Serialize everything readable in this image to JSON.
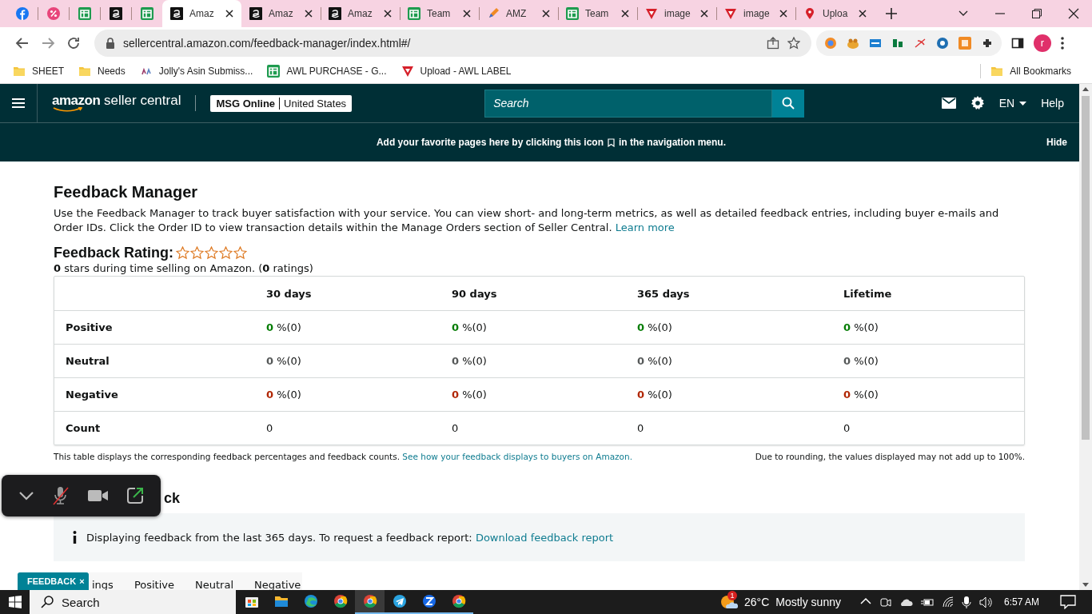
{
  "browser": {
    "tabs": [
      {
        "kind": "facebook",
        "selected": false
      },
      {
        "kind": "percent",
        "selected": false
      },
      {
        "kind": "sheet",
        "selected": false
      },
      {
        "kind": "amazon",
        "selected": false
      },
      {
        "kind": "sheet",
        "selected": false
      },
      {
        "kind": "amazon",
        "title": "Amaz",
        "selected": true
      },
      {
        "kind": "amazon",
        "title": "Amaz",
        "selected": false
      },
      {
        "kind": "amazon",
        "title": "Amaz",
        "selected": false
      },
      {
        "kind": "sheet",
        "title": "Team",
        "selected": false
      },
      {
        "kind": "pen",
        "title": "AMZ",
        "selected": false
      },
      {
        "kind": "sheet",
        "title": "Team",
        "selected": false
      },
      {
        "kind": "triangle",
        "title": "image",
        "selected": false
      },
      {
        "kind": "triangle",
        "title": "image",
        "selected": false
      },
      {
        "kind": "pin",
        "title": "Uploa",
        "selected": false
      }
    ],
    "address": "sellercentral.amazon.com/feedback-manager/index.html#/",
    "profile": "r",
    "bookmarks": [
      {
        "kind": "folder",
        "label": "SHEET"
      },
      {
        "kind": "folder",
        "label": "Needs"
      },
      {
        "kind": "figure",
        "label": "Jolly's Asin Submiss..."
      },
      {
        "kind": "sheet",
        "label": "AWL PURCHASE - G..."
      },
      {
        "kind": "triangle",
        "label": "Upload - AWL LABEL"
      }
    ],
    "all_bookmarks": "All Bookmarks"
  },
  "header": {
    "logo_word": "amazon",
    "logo_rest": "seller central",
    "store": "MSG Online",
    "region": "United States",
    "search_placeholder": "Search",
    "language": "EN",
    "help": "Help"
  },
  "banner": {
    "text_before": "Add your favorite pages here by clicking this icon",
    "text_after": "in the navigation menu.",
    "hide": "Hide"
  },
  "page": {
    "title": "Feedback Manager",
    "intro": "Use the Feedback Manager to track buyer satisfaction with your service. You can view short- and long-term metrics, as well as detailed feedback entries, including buyer e-mails and Order IDs. Click the Order ID to view transaction details within the Manage Orders section of Seller Central.",
    "learn_more": "Learn more",
    "rating_label": "Feedback Rating:",
    "stars": 0,
    "summary": "**0** stars during time selling on Amazon. (**0** ratings)",
    "table": {
      "columns": [
        "30 days",
        "90 days",
        "365 days",
        "Lifetime"
      ],
      "rows": [
        {
          "label": "Positive",
          "kind": "positive",
          "cells": [
            "**0** %(0)",
            "**0** %(0)",
            "**0** %(0)",
            "**0** %(0)"
          ]
        },
        {
          "label": "Neutral",
          "kind": "neutral",
          "cells": [
            "**0** %(0)",
            "**0** %(0)",
            "**0** %(0)",
            "**0** %(0)"
          ]
        },
        {
          "label": "Negative",
          "kind": "negative",
          "cells": [
            "**0** %(0)",
            "**0** %(0)",
            "**0** %(0)",
            "**0** %(0)"
          ]
        },
        {
          "label": "Count",
          "kind": "count",
          "cells": [
            "0",
            "0",
            "0",
            "0"
          ]
        }
      ]
    },
    "table_note": "This table displays the corresponding feedback percentages and feedback counts.",
    "table_note_link": "See how your feedback displays to buyers on Amazon.",
    "rounding_note": "Due to rounding, the values displayed may not add up to 100%.",
    "section_title": "ck",
    "info": "Displaying feedback from the last 365 days. To request a feedback report:",
    "info_link": "Download feedback report",
    "subtabs": [
      "ings",
      "Positive",
      "Neutral",
      "Negative"
    ],
    "feedback_tag": "FEEDBACK",
    "feedback_close": "×"
  },
  "taskbar": {
    "search_placeholder": "Search",
    "apps": [
      {
        "kind": "store",
        "running": false,
        "selected": false
      },
      {
        "kind": "folder",
        "running": false,
        "selected": false
      },
      {
        "kind": "edge",
        "running": false,
        "selected": false
      },
      {
        "kind": "chrome",
        "running": false,
        "selected": false
      },
      {
        "kind": "chrome",
        "running": true,
        "selected": true
      },
      {
        "kind": "telegram",
        "running": true,
        "selected": false
      },
      {
        "kind": "zoom",
        "running": true,
        "selected": false
      },
      {
        "kind": "chrome",
        "running": true,
        "selected": false
      }
    ],
    "weather_badge": "1",
    "temperature": "26°C",
    "condition": "Mostly sunny",
    "clock": "6:57 AM"
  }
}
